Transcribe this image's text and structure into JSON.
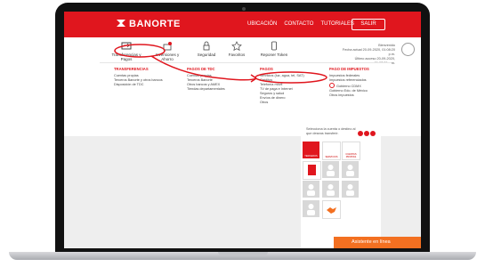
{
  "brand": {
    "name": "BANORTE",
    "color": "#e0161e"
  },
  "nav": {
    "links": [
      "UBICACIÓN",
      "CONTACTO",
      "TUTORIALES"
    ],
    "logout": "SALIR"
  },
  "menu": {
    "items": [
      {
        "label": "Transferencias y Pagos",
        "icon": "transfer-icon"
      },
      {
        "label": "Inversiones y Ahorro",
        "icon": "gift-icon"
      },
      {
        "label": "Seguridad",
        "icon": "lock-icon"
      },
      {
        "label": "Favoritos",
        "icon": "star-icon"
      },
      {
        "label": "Reponer Token",
        "icon": "token-icon"
      }
    ],
    "welcome": "Bienvenido",
    "last_access_1": "Fecha actual 20-09-2020, 01:08:20 p.m.",
    "last_access_2": "Último acceso 20-09-2020, 01:07:59 p.m."
  },
  "dropdown": {
    "columns": [
      {
        "heading": "TRANSFERENCIAS",
        "items": [
          "Cuentas propias",
          "Terceros Banorte y otros bancos",
          "Disposición de TDC"
        ]
      },
      {
        "heading": "PAGOS DE TDC",
        "items": [
          "Cuentas propias",
          "Terceros Banorte",
          "Otros bancos y AMEX",
          "Tiendas departamentales"
        ]
      },
      {
        "heading": "PAGOS",
        "items": [
          "Servicios (luz, agua, tel, SAT)",
          "Créditos",
          "Telefonía móvil",
          "TV de paga e Internet",
          "Seguros y salud",
          "Envíos de dinero",
          "Otros"
        ]
      },
      {
        "heading": "PAGO DE IMPUESTOS",
        "items": [
          "Impuestos federales",
          "Impuestos referenciados",
          "Gobierno CDMX",
          "Gobierno Edo. de México",
          "Otros impuestos"
        ]
      }
    ]
  },
  "panel": {
    "instructions": "Selecciona la cuenta o destino al que deseas transferir.",
    "tiles": [
      {
        "label": "TERCEROS",
        "style": "red"
      },
      {
        "label": "SERVICIOS",
        "style": "white"
      },
      {
        "label": "CUENTAS PROPIAS",
        "style": "white"
      },
      {
        "label": "",
        "style": "white"
      },
      {
        "label": "",
        "style": "gray"
      },
      {
        "label": "",
        "style": "gray"
      },
      {
        "label": "",
        "style": "gray"
      },
      {
        "label": "",
        "style": "gray"
      },
      {
        "label": "",
        "style": "gray"
      },
      {
        "label": "",
        "style": "gray"
      },
      {
        "label": "",
        "style": "white"
      },
      {
        "label": "",
        "style": "white"
      }
    ]
  },
  "assistant": {
    "label": "Asistente en línea"
  }
}
